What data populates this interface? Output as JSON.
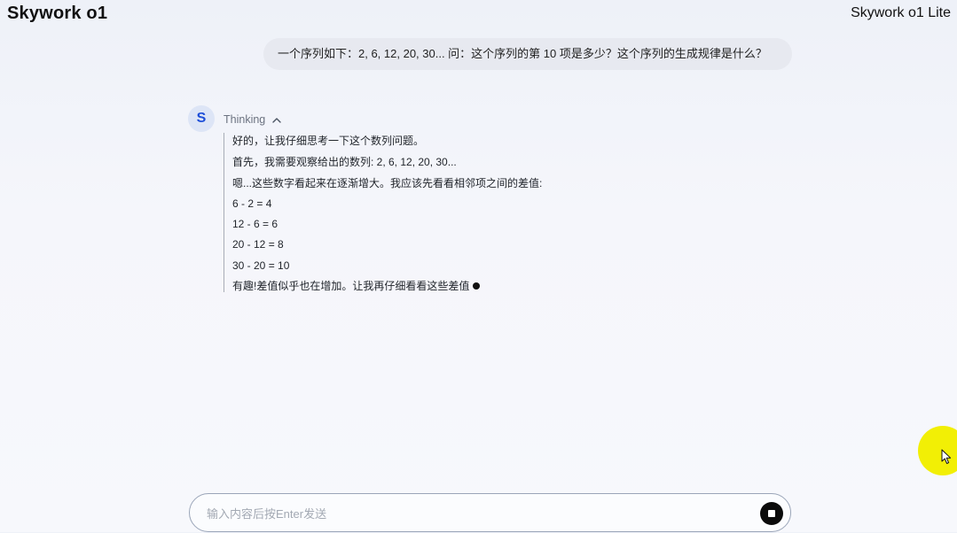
{
  "header": {
    "app_title": "Skywork o1",
    "model_name": "Skywork o1 Lite"
  },
  "conversation": {
    "user_message": "一个序列如下：2, 6, 12, 20, 30... 问：这个序列的第 10 项是多少？这个序列的生成规律是什么？",
    "assistant": {
      "avatar_letter": "S",
      "thinking_label": "Thinking",
      "thinking_toggle_icon": "chevron-up-icon",
      "thinking_lines": [
        "好的，让我仔细思考一下这个数列问题。",
        "首先，我需要观察给出的数列: 2, 6, 12, 20, 30...",
        "嗯...这些数字看起来在逐渐增大。我应该先看看相邻项之间的差值:",
        "6 - 2 = 4",
        "12 - 6 = 6",
        "20 - 12 = 8",
        "30 - 20 = 10",
        "有趣!差值似乎也在增加。让我再仔细看看这些差值"
      ]
    }
  },
  "composer": {
    "placeholder": "输入内容后按Enter发送",
    "value": "",
    "stop_icon": "stop-icon"
  },
  "colors": {
    "background": "#f5f6fb",
    "user_bubble": "#e7e9f0",
    "avatar_bg": "#dde5f6",
    "avatar_text": "#1d4ed8",
    "click_highlight": "#f2ef05"
  }
}
